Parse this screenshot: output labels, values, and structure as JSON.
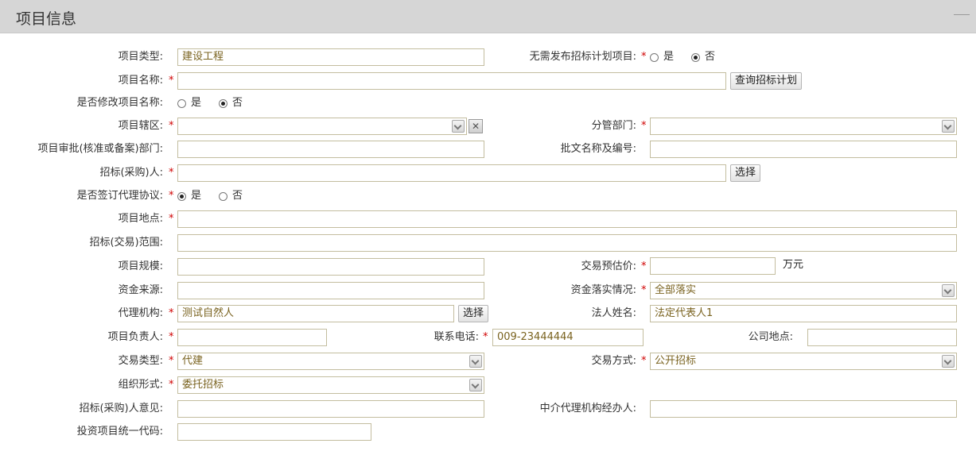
{
  "header": {
    "title": "项目信息"
  },
  "radio": {
    "yes": "是",
    "no": "否"
  },
  "fields": {
    "project_type": {
      "label": "项目类型:",
      "value": "建设工程"
    },
    "no_publish": {
      "label": "无需发布招标计划项目:"
    },
    "project_name": {
      "label": "项目名称:",
      "value": ""
    },
    "query_plan": {
      "label": "查询招标计划"
    },
    "modify_name": {
      "label": "是否修改项目名称:"
    },
    "district": {
      "label": "项目辖区:",
      "value": ""
    },
    "department": {
      "label": "分管部门:",
      "value": ""
    },
    "approval_dept": {
      "label": "项目审批(核准或备案)部门:",
      "value": ""
    },
    "approval_doc": {
      "label": "批文名称及编号:",
      "value": ""
    },
    "tenderer": {
      "label": "招标(采购)人:",
      "value": ""
    },
    "choose": {
      "label": "选择"
    },
    "agency_agreement": {
      "label": "是否签订代理协议:"
    },
    "location": {
      "label": "项目地点:",
      "value": ""
    },
    "scope": {
      "label": "招标(交易)范围:",
      "value": ""
    },
    "scale": {
      "label": "项目规模:",
      "value": ""
    },
    "estimate_price": {
      "label": "交易预估价:",
      "value": "",
      "unit": "万元"
    },
    "fund_source": {
      "label": "资金来源:",
      "value": ""
    },
    "fund_status": {
      "label": "资金落实情况:",
      "value": "全部落实"
    },
    "agency": {
      "label": "代理机构:",
      "value": "测试自然人"
    },
    "legal_person": {
      "label": "法人姓名:",
      "value": "法定代表人1"
    },
    "manager": {
      "label": "项目负责人:",
      "value": ""
    },
    "phone": {
      "label": "联系电话:",
      "value": "009-23444444"
    },
    "company_location": {
      "label": "公司地点:",
      "value": ""
    },
    "trade_type": {
      "label": "交易类型:",
      "value": "代建"
    },
    "trade_method": {
      "label": "交易方式:",
      "value": "公开招标"
    },
    "org_form": {
      "label": "组织形式:",
      "value": "委托招标"
    },
    "tenderer_opinion": {
      "label": "招标(采购)人意见:",
      "value": ""
    },
    "agent_handler": {
      "label": "中介代理机构经办人:",
      "value": ""
    },
    "investment_code": {
      "label": "投资项目统一代码:",
      "value": ""
    }
  },
  "colors": {
    "required": "#d00000",
    "input_border": "#c3bd9f",
    "value_text": "#7a6320",
    "header_bg": "#d6d6d6"
  }
}
